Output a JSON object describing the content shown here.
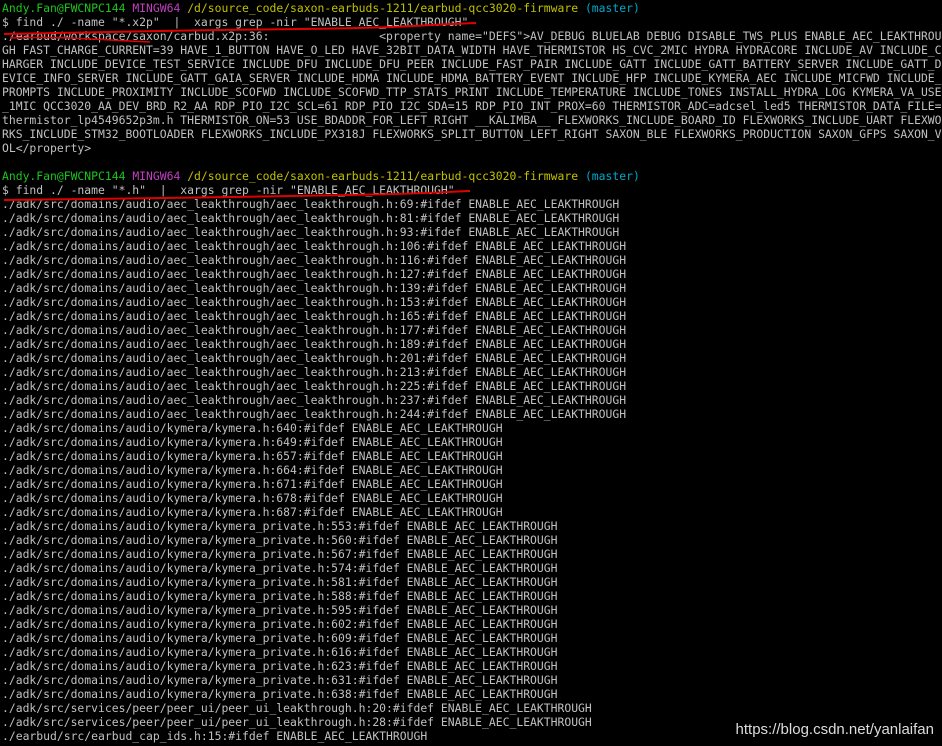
{
  "colors": {
    "background": "#000000",
    "text": "#c0c0c0",
    "user": "#1cc41c",
    "shell": "#c040c0",
    "path": "#c0c000",
    "branch": "#00a8c8",
    "annotation": "#e00000"
  },
  "block1": {
    "prompt": {
      "user": "Andy.Fan@FWCNPC144",
      "shell": "MINGW64",
      "path": "/d/source_code/saxon-earbuds-1211/earbud-qcc3020-firmware",
      "branch": "(master)"
    },
    "command": "$ find ./ -name \"*.x2p\"  |  xargs grep -nir \"ENABLE_AEC_LEAKTHROUGH\"",
    "output": "./earbud/workspace/saxon/carbud.x2p:36:                <property name=\"DEFS\">AV_DEBUG BLUELAB DEBUG DISABLE_TWS_PLUS ENABLE_AEC_LEAKTHROUGH FAST_CHARGE_CURRENT=39 HAVE_1_BUTTON HAVE_O_LED HAVE_32BIT_DATA_WIDTH HAVE_THERMISTOR HS_CVC_2MIC HYDRA HYDRACORE INCLUDE_AV INCLUDE_CHARGER INCLUDE_DEVICE_TEST_SERVICE INCLUDE_DFU INCLUDE_DFU_PEER INCLUDE_FAST_PAIR INCLUDE_GATT INCLUDE_GATT_BATTERY_SERVER INCLUDE_GATT_DEVICE_INFO_SERVER INCLUDE_GATT_GAIA_SERVER INCLUDE_HDMA INCLUDE_HDMA_BATTERY_EVENT INCLUDE_HFP INCLUDE_KYMERA_AEC INCLUDE_MICFWD INCLUDE_PROMPTS INCLUDE_PROXIMITY INCLUDE_SCOFWD INCLUDE_SCOFWD_TTP_STATS_PRINT INCLUDE_TEMPERATURE INCLUDE_TONES INSTALL_HYDRA_LOG KYMERA_VA_USE_1MIC QCC3020_AA_DEV_BRD_R2_AA RDP_PIO_I2C_SCL=61 RDP_PIO_I2C_SDA=15 RDP_PIO_INT_PROX=60 THERMISTOR_ADC=adcsel_led5 THERMISTOR_DATA_FILE=thermistor_lp4549652p3m.h THERMISTOR_ON=53 USE_BDADDR_FOR_LEFT_RIGHT __KALIMBA__ FLEXWORKS_INCLUDE_BOARD_ID FLEXWORKS_INCLUDE_UART FLEXWORKS_INCLUDE_STM32_BOOTLOADER FLEXWORKS_INCLUDE_PX318J FLEXWORKS_SPLIT_BUTTON_LEFT_RIGHT SAXON_BLE FLEXWORKS_PRODUCTION SAXON_GFPS SAXON_VOL</property>"
  },
  "block2": {
    "prompt": {
      "user": "Andy.Fan@FWCNPC144",
      "shell": "MINGW64",
      "path": "/d/source_code/saxon-earbuds-1211/earbud-qcc3020-firmware",
      "branch": "(master)"
    },
    "command": "$ find ./ -name \"*.h\"  |  xargs grep -nir \"ENABLE_AEC_LEAKTHROUGH\"",
    "results": [
      "./adk/src/domains/audio/aec_leakthrough/aec_leakthrough.h:69:#ifdef ENABLE_AEC_LEAKTHROUGH",
      "./adk/src/domains/audio/aec_leakthrough/aec_leakthrough.h:81:#ifdef ENABLE_AEC_LEAKTHROUGH",
      "./adk/src/domains/audio/aec_leakthrough/aec_leakthrough.h:93:#ifdef ENABLE_AEC_LEAKTHROUGH",
      "./adk/src/domains/audio/aec_leakthrough/aec_leakthrough.h:106:#ifdef ENABLE_AEC_LEAKTHROUGH",
      "./adk/src/domains/audio/aec_leakthrough/aec_leakthrough.h:116:#ifdef ENABLE_AEC_LEAKTHROUGH",
      "./adk/src/domains/audio/aec_leakthrough/aec_leakthrough.h:127:#ifdef ENABLE_AEC_LEAKTHROUGH",
      "./adk/src/domains/audio/aec_leakthrough/aec_leakthrough.h:139:#ifdef ENABLE_AEC_LEAKTHROUGH",
      "./adk/src/domains/audio/aec_leakthrough/aec_leakthrough.h:153:#ifdef ENABLE_AEC_LEAKTHROUGH",
      "./adk/src/domains/audio/aec_leakthrough/aec_leakthrough.h:165:#ifdef ENABLE_AEC_LEAKTHROUGH",
      "./adk/src/domains/audio/aec_leakthrough/aec_leakthrough.h:177:#ifdef ENABLE_AEC_LEAKTHROUGH",
      "./adk/src/domains/audio/aec_leakthrough/aec_leakthrough.h:189:#ifdef ENABLE_AEC_LEAKTHROUGH",
      "./adk/src/domains/audio/aec_leakthrough/aec_leakthrough.h:201:#ifdef ENABLE_AEC_LEAKTHROUGH",
      "./adk/src/domains/audio/aec_leakthrough/aec_leakthrough.h:213:#ifdef ENABLE_AEC_LEAKTHROUGH",
      "./adk/src/domains/audio/aec_leakthrough/aec_leakthrough.h:225:#ifdef ENABLE_AEC_LEAKTHROUGH",
      "./adk/src/domains/audio/aec_leakthrough/aec_leakthrough.h:237:#ifdef ENABLE_AEC_LEAKTHROUGH",
      "./adk/src/domains/audio/aec_leakthrough/aec_leakthrough.h:244:#ifdef ENABLE_AEC_LEAKTHROUGH",
      "./adk/src/domains/audio/kymera/kymera.h:640:#ifdef ENABLE_AEC_LEAKTHROUGH",
      "./adk/src/domains/audio/kymera/kymera.h:649:#ifdef ENABLE_AEC_LEAKTHROUGH",
      "./adk/src/domains/audio/kymera/kymera.h:657:#ifdef ENABLE_AEC_LEAKTHROUGH",
      "./adk/src/domains/audio/kymera/kymera.h:664:#ifdef ENABLE_AEC_LEAKTHROUGH",
      "./adk/src/domains/audio/kymera/kymera.h:671:#ifdef ENABLE_AEC_LEAKTHROUGH",
      "./adk/src/domains/audio/kymera/kymera.h:678:#ifdef ENABLE_AEC_LEAKTHROUGH",
      "./adk/src/domains/audio/kymera/kymera.h:687:#ifdef ENABLE_AEC_LEAKTHROUGH",
      "./adk/src/domains/audio/kymera/kymera_private.h:553:#ifdef ENABLE_AEC_LEAKTHROUGH",
      "./adk/src/domains/audio/kymera/kymera_private.h:560:#ifdef ENABLE_AEC_LEAKTHROUGH",
      "./adk/src/domains/audio/kymera/kymera_private.h:567:#ifdef ENABLE_AEC_LEAKTHROUGH",
      "./adk/src/domains/audio/kymera/kymera_private.h:574:#ifdef ENABLE_AEC_LEAKTHROUGH",
      "./adk/src/domains/audio/kymera/kymera_private.h:581:#ifdef ENABLE_AEC_LEAKTHROUGH",
      "./adk/src/domains/audio/kymera/kymera_private.h:588:#ifdef ENABLE_AEC_LEAKTHROUGH",
      "./adk/src/domains/audio/kymera/kymera_private.h:595:#ifdef ENABLE_AEC_LEAKTHROUGH",
      "./adk/src/domains/audio/kymera/kymera_private.h:602:#ifdef ENABLE_AEC_LEAKTHROUGH",
      "./adk/src/domains/audio/kymera/kymera_private.h:609:#ifdef ENABLE_AEC_LEAKTHROUGH",
      "./adk/src/domains/audio/kymera/kymera_private.h:616:#ifdef ENABLE_AEC_LEAKTHROUGH",
      "./adk/src/domains/audio/kymera/kymera_private.h:623:#ifdef ENABLE_AEC_LEAKTHROUGH",
      "./adk/src/domains/audio/kymera/kymera_private.h:631:#ifdef ENABLE_AEC_LEAKTHROUGH",
      "./adk/src/domains/audio/kymera/kymera_private.h:638:#ifdef ENABLE_AEC_LEAKTHROUGH",
      "./adk/src/services/peer/peer_ui/peer_ui_leakthrough.h:20:#ifdef ENABLE_AEC_LEAKTHROUGH",
      "./adk/src/services/peer/peer_ui/peer_ui_leakthrough.h:28:#ifdef ENABLE_AEC_LEAKTHROUGH",
      "./earbud/src/earbud_cap_ids.h:15:#ifdef ENABLE_AEC_LEAKTHROUGH"
    ]
  },
  "watermark": "https://blog.csdn.net/yanlaifan"
}
